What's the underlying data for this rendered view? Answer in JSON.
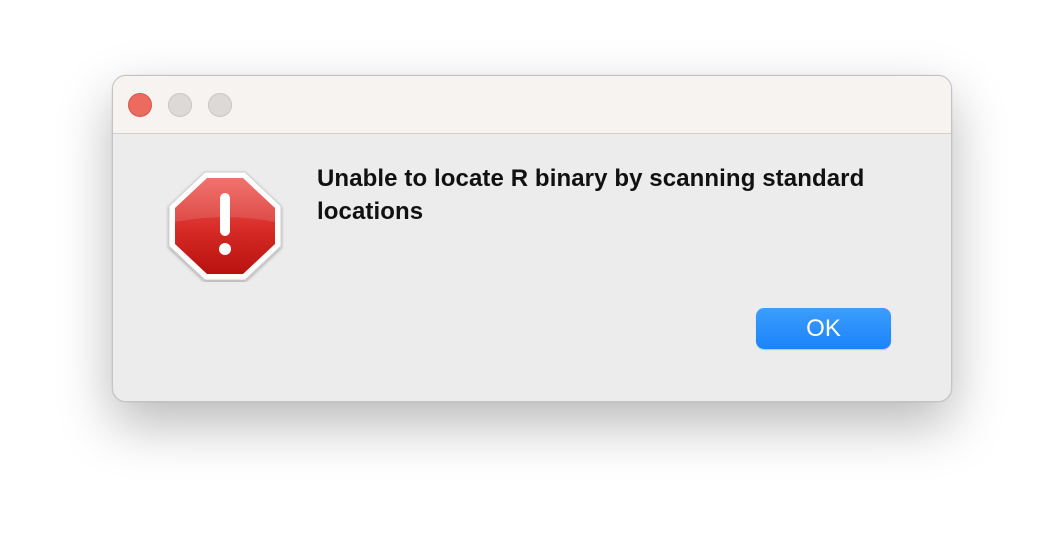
{
  "dialog": {
    "message": "Unable to locate R binary by scanning standard locations",
    "icon": "stop-alert-icon",
    "ok_label": "OK"
  },
  "window_controls": {
    "close": "close-button",
    "minimize": "minimize-button",
    "zoom": "zoom-button"
  },
  "colors": {
    "close_red": "#ec6a5e",
    "accent_blue": "#1b84fa",
    "alert_red": "#c4151c",
    "dialog_background": "#ececec"
  }
}
